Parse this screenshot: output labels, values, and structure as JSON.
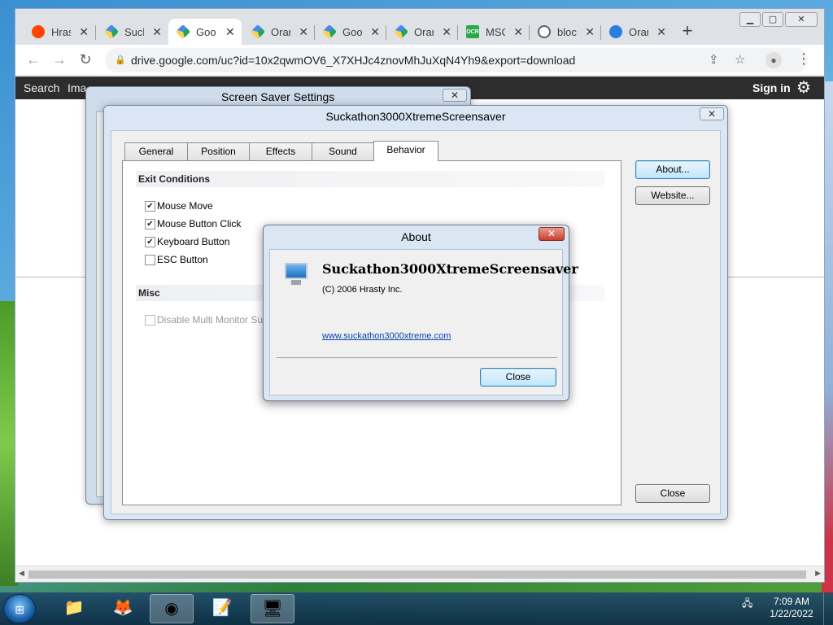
{
  "browser": {
    "tabs": [
      {
        "title": "Hras",
        "icon": "reddit-icon"
      },
      {
        "title": "Suck",
        "icon": "drive-icon"
      },
      {
        "title": "Goo",
        "icon": "drive-icon",
        "active": true
      },
      {
        "title": "Orar",
        "icon": "drive-icon"
      },
      {
        "title": "Goo",
        "icon": "drive-icon"
      },
      {
        "title": "Orar",
        "icon": "drive-icon"
      },
      {
        "title": "MSC",
        "icon": "ocr-icon"
      },
      {
        "title": "bloc",
        "icon": "globe-icon"
      },
      {
        "title": "Orar",
        "icon": "edge-icon"
      }
    ],
    "ocr_badge": "OCR",
    "new_tab": "+",
    "url": "drive.google.com/uc?id=10x2qwmOV6_X7XHJc4znovMhJuXqN4Yh9&export=download",
    "google_bar": {
      "links": [
        "Search",
        "Ima"
      ],
      "sign_in": "Sign in"
    }
  },
  "screen_saver_settings": {
    "title": "Screen Saver Settings"
  },
  "app_dialog": {
    "title": "Suckathon3000XtremeScreensaver",
    "tabs": [
      "General",
      "Position",
      "Effects",
      "Sound",
      "Behavior"
    ],
    "active_tab": "Behavior",
    "exit_conditions": {
      "heading": "Exit Conditions",
      "options": [
        {
          "label": "Mouse Move",
          "checked": true
        },
        {
          "label": "Mouse Button Click",
          "checked": true
        },
        {
          "label": "Keyboard Button",
          "checked": true
        },
        {
          "label": "ESC Button",
          "checked": false
        }
      ]
    },
    "misc": {
      "heading": "Misc",
      "options": [
        {
          "label": "Disable Multi Monitor Suppo",
          "checked": false,
          "disabled": true
        }
      ]
    },
    "buttons": {
      "about": "About...",
      "website": "Website...",
      "close": "Close"
    }
  },
  "about_dialog": {
    "title": "About",
    "product": "Suckathon3000XtremeScreensaver",
    "copyright": "(C) 2006 Hrasty Inc.",
    "link": "www.suckathon3000xtreme.com",
    "close": "Close"
  },
  "taskbar": {
    "apps": [
      "explorer",
      "firefox",
      "chrome",
      "notepad",
      "screensaver"
    ],
    "active_app": "chrome",
    "time": "7:09 AM",
    "date": "1/22/2022"
  },
  "colors": {
    "link": "#0645ad",
    "close_red": "#c8402c",
    "focus_blue": "#3c7fb1"
  }
}
